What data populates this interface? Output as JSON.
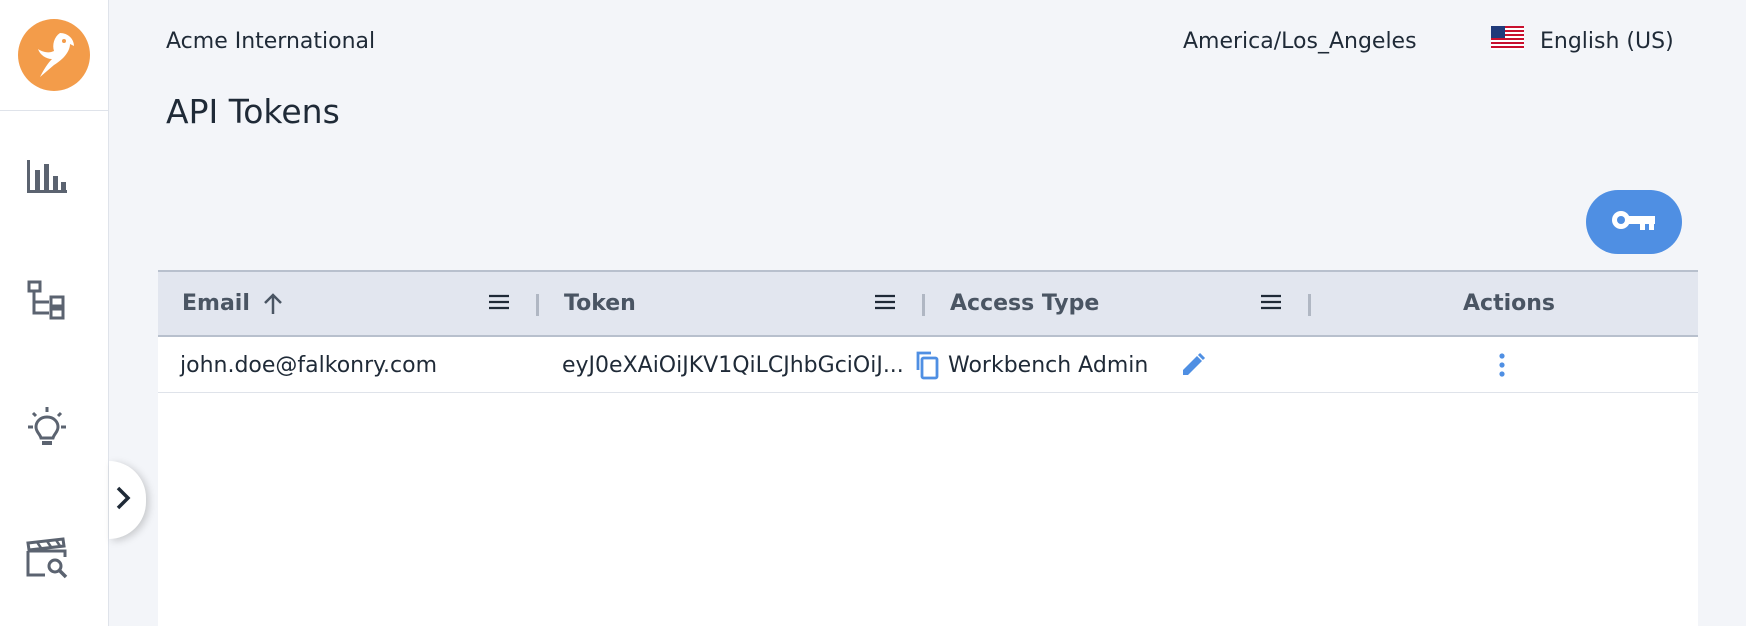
{
  "header": {
    "org_name": "Acme International",
    "timezone": "America/Los_Angeles",
    "language": "English (US)",
    "language_flag_icon": "us-flag-icon"
  },
  "page": {
    "title": "API Tokens",
    "add_token_icon": "key-icon"
  },
  "sidebar": {
    "logo_icon": "falcon-logo-icon",
    "items": [
      {
        "icon": "bar-chart-icon"
      },
      {
        "icon": "hierarchy-icon"
      },
      {
        "icon": "lightbulb-icon"
      },
      {
        "icon": "clapper-search-icon"
      }
    ],
    "expand_icon": "chevron-right-icon"
  },
  "table": {
    "columns": [
      {
        "label": "Email",
        "sort": "ascending"
      },
      {
        "label": "Token"
      },
      {
        "label": "Access Type"
      },
      {
        "label": "Actions"
      }
    ],
    "rows": [
      {
        "email": "john.doe@falkonry.com",
        "token": "eyJ0eXAiOiJKV1QiLCJhbGciOiJ...",
        "access_type": "Workbench Admin"
      }
    ]
  },
  "colors": {
    "accent": "#4f8fe3",
    "logo": "#f39c4a",
    "background": "#f3f5f9",
    "header_row": "#e2e6ef"
  }
}
